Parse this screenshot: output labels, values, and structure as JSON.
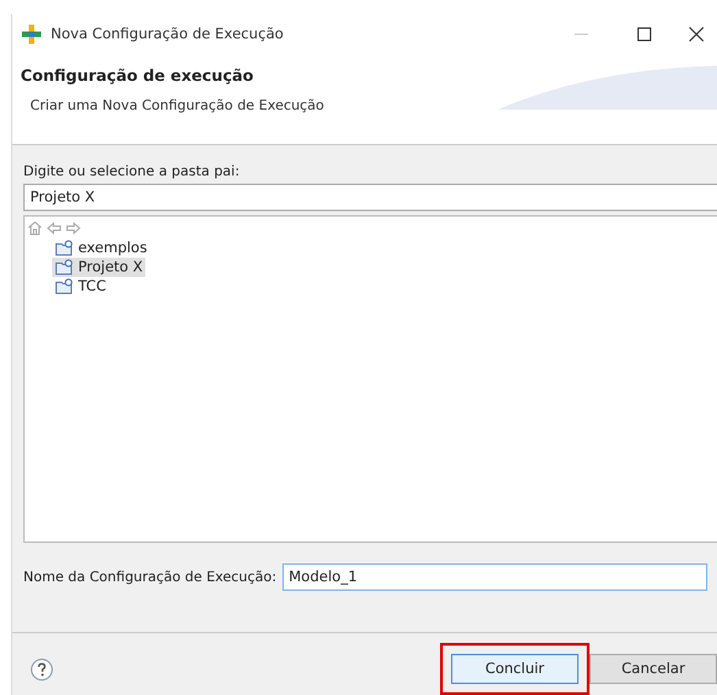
{
  "window": {
    "title": "Nova Configuração de Execução"
  },
  "header": {
    "title": "Configuração de execução",
    "description": "Criar uma Nova Configuração de Execução"
  },
  "folder": {
    "label": "Digite ou selecione a pasta pai:",
    "value": "Projeto X"
  },
  "tree": {
    "items": [
      {
        "label": "exemplos",
        "selected": false
      },
      {
        "label": "Projeto X",
        "selected": true
      },
      {
        "label": "TCC",
        "selected": false
      }
    ]
  },
  "name_field": {
    "label": "Nome da Configuração de Execução:",
    "value": "Modelo_1"
  },
  "buttons": [
    {
      "label": "Concluir",
      "kind": "primary",
      "highlighted": true
    },
    {
      "label": "Cancelar",
      "kind": "normal",
      "highlighted": false
    }
  ]
}
